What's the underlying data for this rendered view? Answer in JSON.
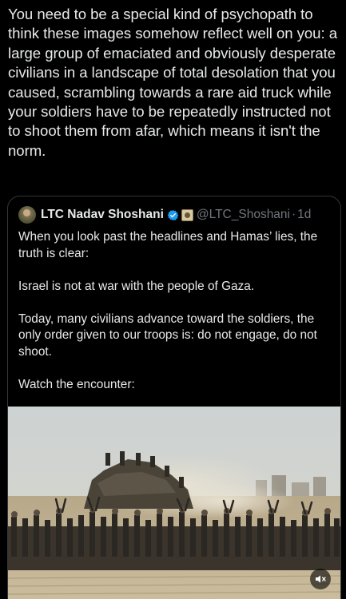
{
  "tweet": {
    "text": "You need to be a special kind of psychopath to think these images somehow reflect well on you: a large group of emaciated and obviously desperate civilians in a landscape of total desolation that you caused, scrambling towards a rare aid truck while your soldiers have to be repeatedly instructed not to shoot them from afar, which means it isn't the norm."
  },
  "quoted_tweet": {
    "display_name": "LTC Nadav Shoshani",
    "handle": "@LTC_Shoshani",
    "separator": "·",
    "time": "1d",
    "verified_icon": "verified-badge-icon",
    "affiliation_icon": "affiliation-badge-icon",
    "text": "When you look past the headlines and Hamas’ lies, the truth is clear:\n\nIsrael is not at war with the people of Gaza.\n\nToday, many civilians advance toward the soldiers, the only order given to our troops is: do not engage, do not shoot.\n\nWatch the encounter:",
    "media": {
      "type": "video",
      "control_icon": "speaker-muted-icon"
    }
  },
  "colors": {
    "background": "#000000",
    "text": "#e7e9ea",
    "secondary_text": "#71767b",
    "border": "#333639",
    "verified_blue": "#1d9bf0"
  }
}
